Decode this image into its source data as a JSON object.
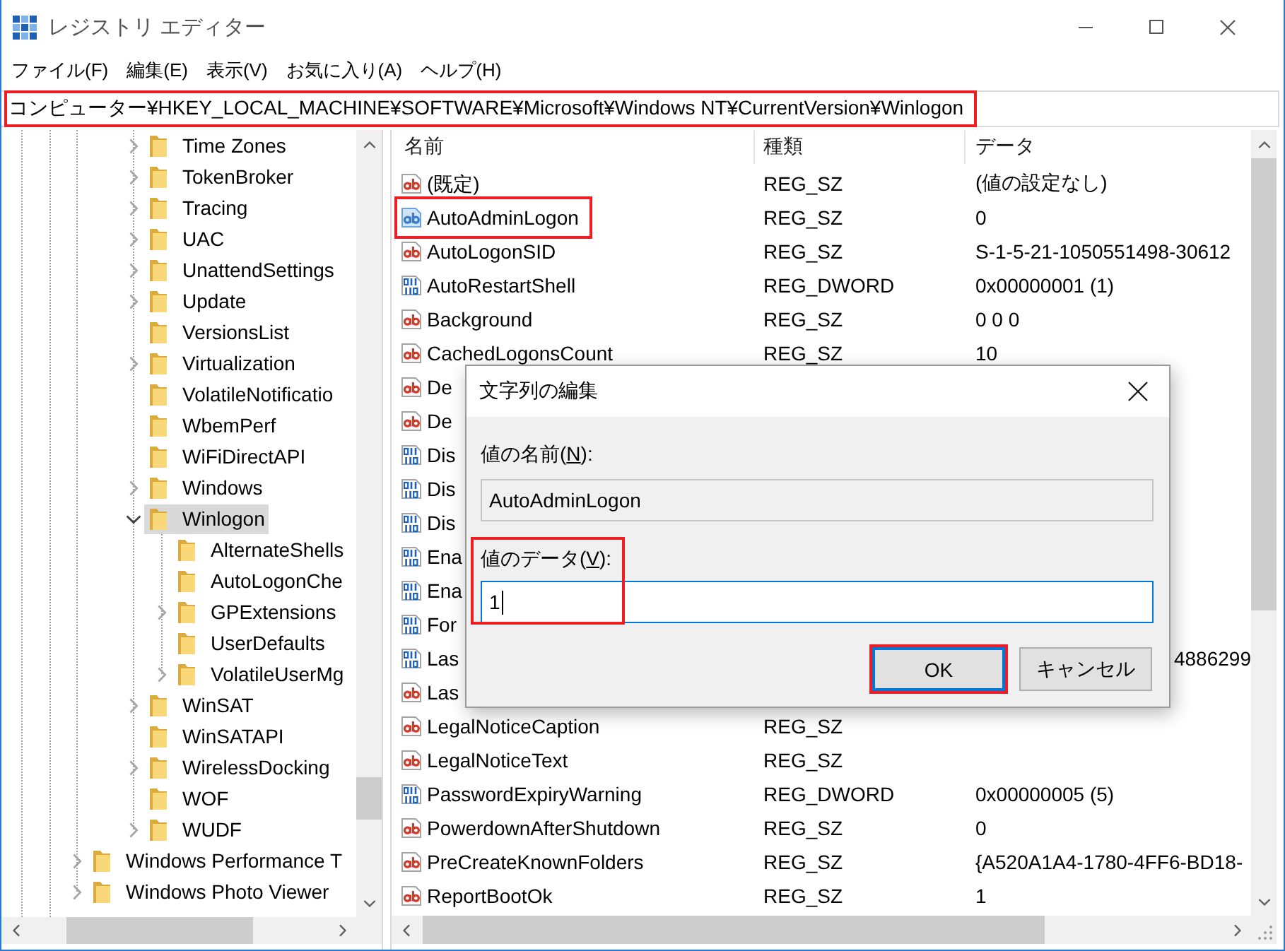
{
  "window": {
    "title": "レジストリ エディター"
  },
  "menu": [
    "ファイル(F)",
    "編集(E)",
    "表示(V)",
    "お気に入り(A)",
    "ヘルプ(H)"
  ],
  "address_bar": {
    "path": "コンピューター¥HKEY_LOCAL_MACHINE¥SOFTWARE¥Microsoft¥Windows NT¥CurrentVersion¥Winlogon",
    "highlighted": true
  },
  "tree": {
    "items": [
      {
        "children": [
          {
            "children": [
              {
                "label": "Time Zones",
                "expandable": true,
                "expanded": false,
                "selected": false
              },
              {
                "label": "TokenBroker",
                "expandable": true,
                "expanded": false,
                "selected": false
              },
              {
                "label": "Tracing",
                "expandable": true,
                "expanded": false,
                "selected": false
              },
              {
                "label": "UAC",
                "expandable": true,
                "expanded": false,
                "selected": false
              },
              {
                "label": "UnattendSettings",
                "expandable": true,
                "expanded": false,
                "selected": false
              },
              {
                "label": "Update",
                "expandable": true,
                "expanded": false,
                "selected": false
              },
              {
                "label": "VersionsList",
                "expandable": false,
                "expanded": false,
                "selected": false
              },
              {
                "label": "Virtualization",
                "expandable": true,
                "expanded": false,
                "selected": false
              },
              {
                "label": "VolatileNotificatio",
                "expandable": false,
                "expanded": false,
                "selected": false
              },
              {
                "label": "WbemPerf",
                "expandable": false,
                "expanded": false,
                "selected": false
              },
              {
                "label": "WiFiDirectAPI",
                "expandable": false,
                "expanded": false,
                "selected": false
              },
              {
                "label": "Windows",
                "expandable": true,
                "expanded": false,
                "selected": false
              },
              {
                "label": "Winlogon",
                "expandable": true,
                "expanded": true,
                "selected": true,
                "children": [
                  {
                    "label": "AlternateShells",
                    "expandable": false,
                    "expanded": false,
                    "selected": false
                  },
                  {
                    "label": "AutoLogonChe",
                    "expandable": false,
                    "expanded": false,
                    "selected": false
                  },
                  {
                    "label": "GPExtensions",
                    "expandable": true,
                    "expanded": false,
                    "selected": false
                  },
                  {
                    "label": "UserDefaults",
                    "expandable": false,
                    "expanded": false,
                    "selected": false
                  },
                  {
                    "label": "VolatileUserMg",
                    "expandable": true,
                    "expanded": false,
                    "selected": false
                  }
                ]
              },
              {
                "label": "WinSAT",
                "expandable": true,
                "expanded": false,
                "selected": false
              },
              {
                "label": "WinSATAPI",
                "expandable": false,
                "expanded": false,
                "selected": false
              },
              {
                "label": "WirelessDocking",
                "expandable": true,
                "expanded": false,
                "selected": false
              },
              {
                "label": "WOF",
                "expandable": false,
                "expanded": false,
                "selected": false
              },
              {
                "label": "WUDF",
                "expandable": true,
                "expanded": false,
                "selected": false
              }
            ]
          }
        ]
      },
      {
        "label": "Windows Performance T",
        "expandable": true,
        "expanded": false,
        "selected": false
      },
      {
        "label": "Windows Photo Viewer",
        "expandable": true,
        "expanded": false,
        "selected": false
      }
    ]
  },
  "list": {
    "columns": [
      "名前",
      "種類",
      "データ"
    ],
    "rows": [
      {
        "kind": "string",
        "name": "(既定)",
        "type": "REG_SZ",
        "data": "(値の設定なし)",
        "selected": false,
        "highlighted": false
      },
      {
        "kind": "string",
        "name": "AutoAdminLogon",
        "type": "REG_SZ",
        "data": "0",
        "selected": true,
        "highlighted": true
      },
      {
        "kind": "string",
        "name": "AutoLogonSID",
        "type": "REG_SZ",
        "data": "S-1-5-21-1050551498-30612",
        "selected": false,
        "highlighted": false
      },
      {
        "kind": "binary",
        "name": "AutoRestartShell",
        "type": "REG_DWORD",
        "data": "0x00000001 (1)",
        "selected": false,
        "highlighted": false
      },
      {
        "kind": "string",
        "name": "Background",
        "type": "REG_SZ",
        "data": "0 0 0",
        "selected": false,
        "highlighted": false
      },
      {
        "kind": "string",
        "name": "CachedLogonsCount",
        "type": "REG_SZ",
        "data": "10",
        "selected": false,
        "highlighted": false
      },
      {
        "kind": "string",
        "name": "De",
        "selected": false,
        "highlighted": false
      },
      {
        "kind": "string",
        "name": "De",
        "selected": false,
        "highlighted": false
      },
      {
        "kind": "binary",
        "name": "Dis",
        "selected": false,
        "highlighted": false
      },
      {
        "kind": "binary",
        "name": "Dis",
        "selected": false,
        "highlighted": false
      },
      {
        "kind": "binary",
        "name": "Dis",
        "selected": false,
        "highlighted": false
      },
      {
        "kind": "binary",
        "name": "Ena",
        "selected": false,
        "highlighted": false
      },
      {
        "kind": "binary",
        "name": "Ena",
        "selected": false,
        "highlighted": false
      },
      {
        "kind": "binary",
        "name": "For",
        "selected": false,
        "highlighted": false
      },
      {
        "kind": "binary",
        "name": "Las",
        "data": "4886299",
        "selected": false,
        "highlighted": false
      },
      {
        "kind": "string",
        "name": "Las",
        "selected": false,
        "highlighted": false
      },
      {
        "kind": "string",
        "name": "LegalNoticeCaption",
        "type": "REG_SZ",
        "selected": false,
        "highlighted": false
      },
      {
        "kind": "string",
        "name": "LegalNoticeText",
        "type": "REG_SZ",
        "selected": false,
        "highlighted": false
      },
      {
        "kind": "binary",
        "name": "PasswordExpiryWarning",
        "type": "REG_DWORD",
        "data": "0x00000005 (5)",
        "selected": false,
        "highlighted": false
      },
      {
        "kind": "string",
        "name": "PowerdownAfterShutdown",
        "type": "REG_SZ",
        "data": "0",
        "selected": false,
        "highlighted": false
      },
      {
        "kind": "string",
        "name": "PreCreateKnownFolders",
        "type": "REG_SZ",
        "data": "{A520A1A4-1780-4FF6-BD18-",
        "selected": false,
        "highlighted": false
      },
      {
        "kind": "string",
        "name": "ReportBootOk",
        "type": "REG_SZ",
        "data": "1",
        "selected": false,
        "highlighted": false
      }
    ]
  },
  "dialog": {
    "title": "文字列の編集",
    "value_name": {
      "label_before": "値の名前(",
      "access_key": "N",
      "label_after": "):",
      "value": "AutoAdminLogon",
      "read_only": true,
      "focused": false,
      "highlighted": false
    },
    "value_data": {
      "label_before": "値のデータ(",
      "access_key": "V",
      "label_after": "):",
      "value": "1",
      "read_only": false,
      "focused": true,
      "highlighted": true
    },
    "buttons": [
      {
        "label": "OK",
        "default": true,
        "highlighted": true
      },
      {
        "label": "キャンセル",
        "default": false,
        "highlighted": false
      }
    ]
  }
}
